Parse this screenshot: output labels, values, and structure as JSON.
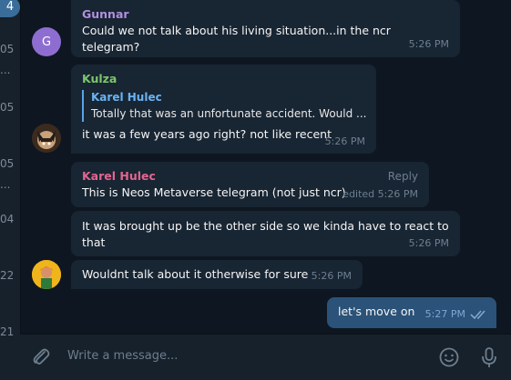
{
  "sidebar": {
    "badge": "4",
    "items": [
      "05",
      "...",
      "05",
      "05",
      "...",
      "04",
      "22",
      "21"
    ]
  },
  "messages": [
    {
      "sender": "Gunnar",
      "avatar_letter": "G",
      "text": "Could we not talk about his living situation...in the ncr telegram?",
      "time": "5:26 PM"
    },
    {
      "sender": "Kulza",
      "quote_name": "Karel Hulec",
      "quote_text": "Totally that was an unfortunate accident. Would ...",
      "text": "it was a few years ago right? not like recent",
      "time": "5:26 PM"
    },
    {
      "sender": "Karel Hulec",
      "reply_label": "Reply",
      "text": "This is Neos Metaverse telegram (not just ncr)",
      "time": "edited 5:26 PM"
    },
    {
      "text_line1": "It was brought up be the other side so we kinda have to react to",
      "text_line2": "that",
      "time": "5:26 PM"
    },
    {
      "text": "Wouldnt talk about it otherwise for sure",
      "time": "5:26 PM"
    },
    {
      "text": "let's move on",
      "time": "5:27 PM",
      "status": "double-check-icon"
    }
  ],
  "input": {
    "placeholder": "Write a message..."
  },
  "colors": {
    "gunnar": "#b38fdf",
    "kulza": "#7ec66b",
    "karel": "#e3658f",
    "link": "#6ab3f3",
    "outgoing": "#2b5278"
  }
}
